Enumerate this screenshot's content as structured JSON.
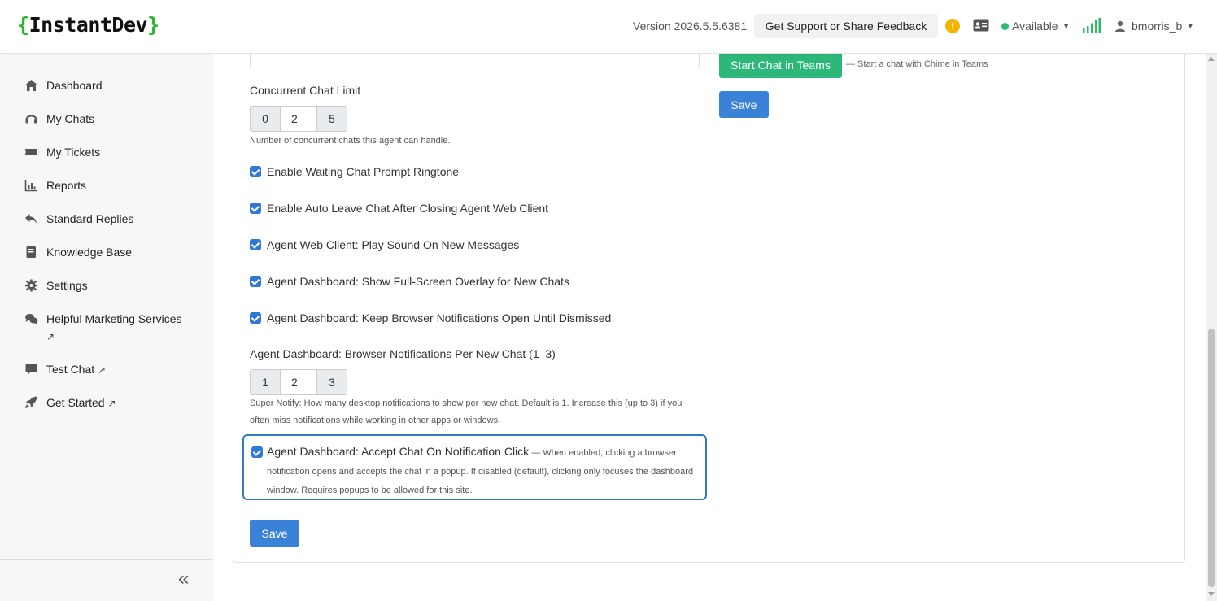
{
  "header": {
    "logo_open": "{",
    "logo_text": "InstantDev",
    "logo_close": "}",
    "version": "Version 2026.5.5.6381",
    "support_label": "Get Support or Share Feedback",
    "alert_glyph": "!",
    "status_label": "Available",
    "status_color": "#2dba6b",
    "username": "bmorris_b"
  },
  "sidebar": {
    "items": [
      {
        "label": "Dashboard",
        "icon": "home-icon"
      },
      {
        "label": "My Chats",
        "icon": "headset-icon"
      },
      {
        "label": "My Tickets",
        "icon": "ticket-icon"
      },
      {
        "label": "Reports",
        "icon": "chart-icon"
      },
      {
        "label": "Standard Replies",
        "icon": "reply-icon"
      },
      {
        "label": "Knowledge Base",
        "icon": "book-icon"
      },
      {
        "label": "Settings",
        "icon": "gear-icon"
      },
      {
        "label": "Helpful Marketing Services",
        "ext": "↗",
        "icon": "comments-icon"
      },
      {
        "label": "Test Chat",
        "ext": "↗",
        "icon": "comment-icon"
      },
      {
        "label": "Get Started",
        "ext": "↗",
        "icon": "rocket-icon"
      }
    ],
    "collapse_glyph": "«"
  },
  "form": {
    "concurrent_label": "Concurrent Chat Limit",
    "concurrent": {
      "min": "0",
      "value": "2",
      "max": "5"
    },
    "concurrent_help": "Number of concurrent chats this agent can handle.",
    "checkboxes": [
      {
        "label": "Enable Waiting Chat Prompt Ringtone",
        "checked": true
      },
      {
        "label": "Enable Auto Leave Chat After Closing Agent Web Client",
        "checked": true
      },
      {
        "label": "Agent Web Client: Play Sound On New Messages",
        "checked": true
      },
      {
        "label": "Agent Dashboard: Show Full-Screen Overlay for New Chats",
        "checked": true
      },
      {
        "label": "Agent Dashboard: Keep Browser Notifications Open Until Dismissed",
        "checked": true
      }
    ],
    "notif_label": "Agent Dashboard: Browser Notifications Per New Chat (1–3)",
    "notif": {
      "min": "1",
      "value": "2",
      "max": "3"
    },
    "notif_help": "Super Notify: How many desktop notifications to show per new chat. Default is 1. Increase this (up to 3) if you often miss notifications while working in other apps or windows.",
    "accept": {
      "label": "Agent Dashboard: Accept Chat On Notification Click",
      "desc": " — When enabled, clicking a browser notification opens and accepts the chat in a popup. If disabled (default), clicking only focuses the dashboard window. Requires popups to be allowed for this site.",
      "checked": true
    },
    "save_label": "Save"
  },
  "teams": {
    "button_label": "Start Chat in Teams",
    "help": "— Start a chat with Chime in Teams",
    "save_label": "Save"
  },
  "colors": {
    "accent_blue": "#3a82d8",
    "accent_green": "#2db87a",
    "highlight_border": "#2f7ac0"
  }
}
